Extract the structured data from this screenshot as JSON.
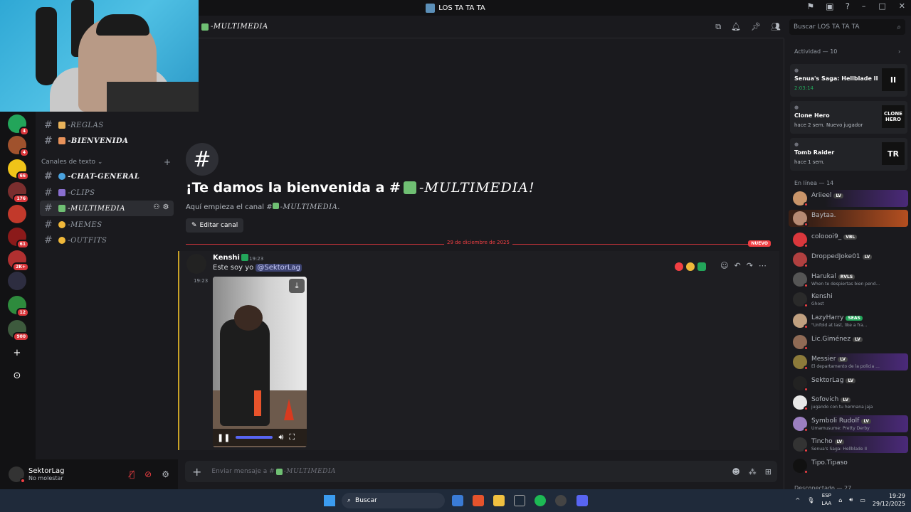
{
  "window": {
    "title": "LOS TA TA TA"
  },
  "header": {
    "channel": "-MULTIMEDIA",
    "search_placeholder": "Buscar LOS TA TA TA"
  },
  "servers": [
    {
      "badge": "4"
    },
    {
      "badge": "4"
    },
    {
      "badge": "66"
    },
    {
      "badge": "176"
    },
    {
      "badge": ""
    },
    {
      "badge": "61"
    },
    {
      "badge": "2K+"
    },
    {
      "badge": ""
    },
    {
      "badge": "12"
    },
    {
      "badge": "900"
    }
  ],
  "channels": {
    "category": "Canales de texto",
    "items": [
      {
        "label": "-REGLAS"
      },
      {
        "label": "-BIENVENIDA"
      },
      {
        "label": "-CHAT-GENERAL"
      },
      {
        "label": "-CLIPS"
      },
      {
        "label": "-MULTIMEDIA"
      },
      {
        "label": "-MEMES"
      },
      {
        "label": "-OUTFITS"
      }
    ]
  },
  "user": {
    "name": "SektorLag",
    "status": "No molestar"
  },
  "welcome": {
    "title_prefix": "¡Te damos la bienvenida a #",
    "title_channel": "-MULTIMEDIA!",
    "sub_prefix": "Aquí empieza el canal #",
    "sub_channel": "-MULTIMEDIA.",
    "edit_label": "Editar canal"
  },
  "divider": {
    "date": "29 de diciembre de 2025",
    "new_label": "NUEVO"
  },
  "message": {
    "author": "Kenshi",
    "time": "19:23",
    "time2": "19:23",
    "text": "Este soy yo ",
    "mention": "@SektorLag"
  },
  "composer": {
    "placeholder_prefix": "Enviar mensaje a #",
    "placeholder_channel": "-MULTIMEDIA"
  },
  "members": {
    "activity_header": "Actividad — 10",
    "activities": [
      {
        "name": "Senua's Saga: Hellblade II",
        "meta": "2:03:14",
        "thumb": "II"
      },
      {
        "name": "Clone Hero",
        "meta": "hace 2 sem.   Nuevo jugador",
        "thumb": "CLONE HERO"
      },
      {
        "name": "Tomb Raider",
        "meta": "hace 1 sem.",
        "thumb": "TR"
      }
    ],
    "online_header": "En línea — 14",
    "list": [
      {
        "name": "Ariieel",
        "tag": "LV",
        "sub": ""
      },
      {
        "name": "Baytaa.",
        "tag": "",
        "sub": ""
      },
      {
        "name": "coloooi9_",
        "tag": "VBL",
        "sub": ""
      },
      {
        "name": "DroppedJoke01",
        "tag": "LV",
        "sub": ""
      },
      {
        "name": "Harukal",
        "tag": "RVLS",
        "sub": "When te despiertas bien pend..."
      },
      {
        "name": "Kenshi",
        "tag": "",
        "sub": "Ghost"
      },
      {
        "name": "LazyHarry",
        "tag": "SEAS",
        "sub": "\"Unfold at last, like a fra..."
      },
      {
        "name": "Lic.Giménez",
        "tag": "LV",
        "sub": ""
      },
      {
        "name": "Messier",
        "tag": "LV",
        "sub": "El departamento de la policia ..."
      },
      {
        "name": "SektorLag",
        "tag": "LV",
        "sub": ""
      },
      {
        "name": "Sofovich",
        "tag": "LV",
        "sub": "jugando con tu hermana jaja"
      },
      {
        "name": "Symboli Rudolf",
        "tag": "LV",
        "sub": "Umamusume: Pretty Derby"
      },
      {
        "name": "Tincho",
        "tag": "LV",
        "sub": "Senua's Saga: Hellblade II"
      },
      {
        "name": "Tipo.Tipaso",
        "tag": "",
        "sub": ""
      }
    ],
    "offline_header": "Desconectado — 27"
  },
  "taskbar": {
    "search": "Buscar",
    "lang": "ESP",
    "lang2": "LAA",
    "time": "19:29",
    "date": "29/12/2025"
  }
}
